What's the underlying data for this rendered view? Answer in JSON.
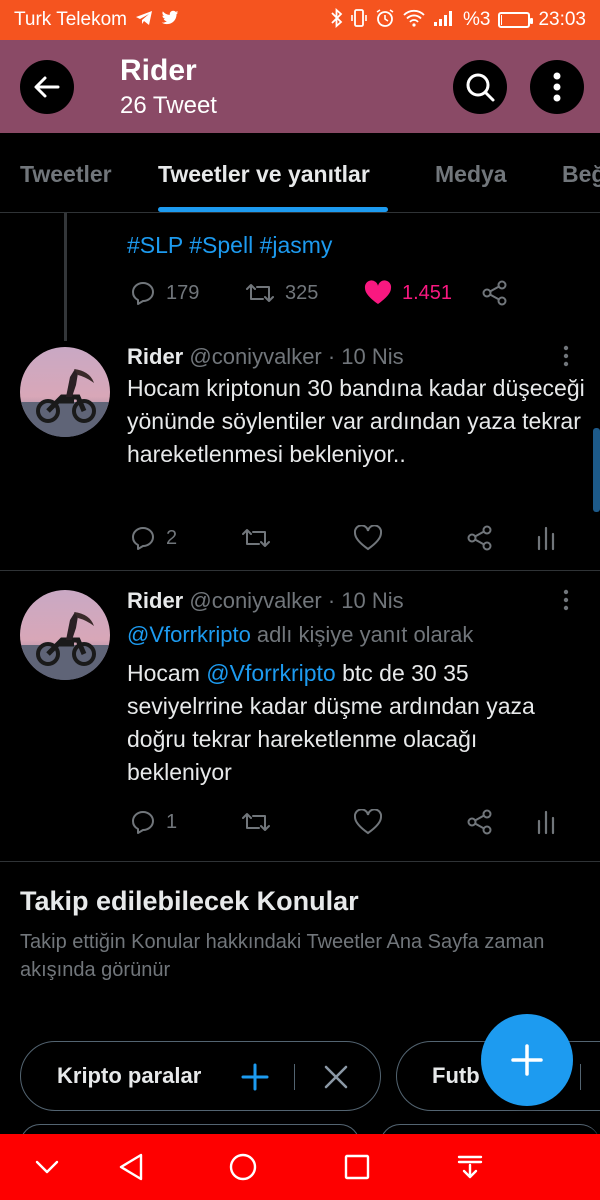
{
  "status_bar": {
    "carrier": "Turk Telekom",
    "battery_text": "%3",
    "battery_level": 0.03,
    "time": "23:03"
  },
  "header": {
    "title": "Rider",
    "subtitle": "26 Tweet"
  },
  "tabs": [
    "Tweetler",
    "Tweetler ve yanıtlar",
    "Medya",
    "Beğ"
  ],
  "prev_tweet": {
    "hashtags": "#SLP #Spell #jasmy",
    "replies": "179",
    "retweets": "325",
    "likes": "1.451"
  },
  "tweets": [
    {
      "name": "Rider",
      "meta": "@coniyvalker · 10 Nis",
      "text": "Hocam kriptonun 30 bandına kadar düşeceği yönünde söylentiler var ardından yaza tekrar hareketlenmesi bekleniyor..",
      "replies": "2"
    },
    {
      "name": "Rider",
      "meta": "@coniyvalker · 10 Nis",
      "reply_handle": "@Vforrkripto",
      "reply_suffix": " adlı kişiye yanıt olarak",
      "text_prefix": "Hocam ",
      "text_mention": "@Vforrkripto",
      "text_rest": " btc de 30 35 seviyelrrine kadar düşme ardından yaza doğru tekrar hareketlenme olacağı bekleniyor",
      "replies": "1"
    }
  ],
  "topics": {
    "title": "Takip edilebilecek Konular",
    "description": "Takip ettiğin Konular hakkındaki Tweetler Ana Sayfa zaman akışında görünür",
    "chips": [
      "Kripto paralar",
      "Futb"
    ]
  },
  "colors": {
    "status_bar": "#f5541f",
    "header": "#8a4a66",
    "accent": "#1d9bf0",
    "like": "#f91880",
    "nav_bar": "#fe0000"
  }
}
